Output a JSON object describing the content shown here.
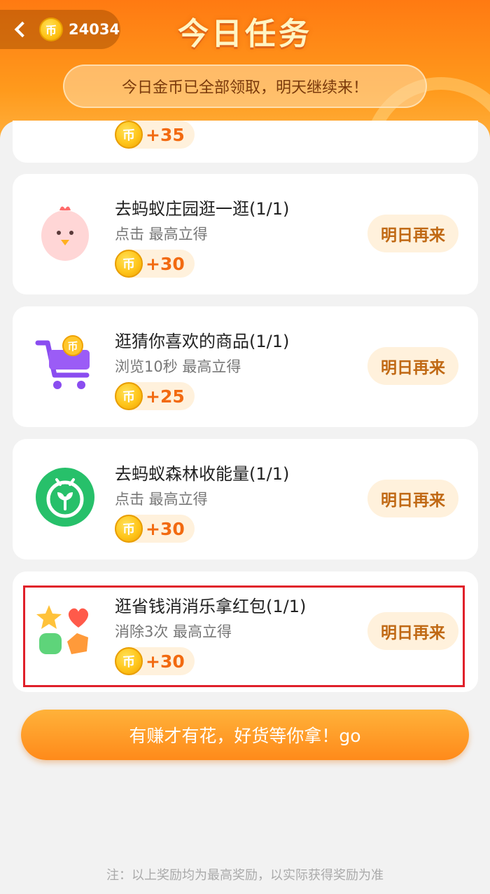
{
  "header": {
    "coin_balance": "24034",
    "coin_glyph": "币",
    "title": "今日任务",
    "notice": "今日金币已全部领取，明天继续来！"
  },
  "partial_task": {
    "reward": "+35"
  },
  "tasks": [
    {
      "title": "去蚂蚁庄园逛一逛(1/1)",
      "subtitle": "点击 最高立得",
      "reward": "+30",
      "button": "明日再来",
      "icon": "chick-icon"
    },
    {
      "title": "逛猜你喜欢的商品(1/1)",
      "subtitle": "浏览10秒 最高立得",
      "reward": "+25",
      "button": "明日再来",
      "icon": "shopping-cart-icon"
    },
    {
      "title": "去蚂蚁森林收能量(1/1)",
      "subtitle": "点击 最高立得",
      "reward": "+30",
      "button": "明日再来",
      "icon": "sprout-icon"
    },
    {
      "title": "逛省钱消消乐拿红包(1/1)",
      "subtitle": "消除3次 最高立得",
      "reward": "+30",
      "button": "明日再来",
      "icon": "match-game-icon"
    }
  ],
  "cta": {
    "label": "有赚才有花，好货等你拿！go"
  },
  "footnote": "注：以上奖励均为最高奖励，以实际获得奖励为准"
}
